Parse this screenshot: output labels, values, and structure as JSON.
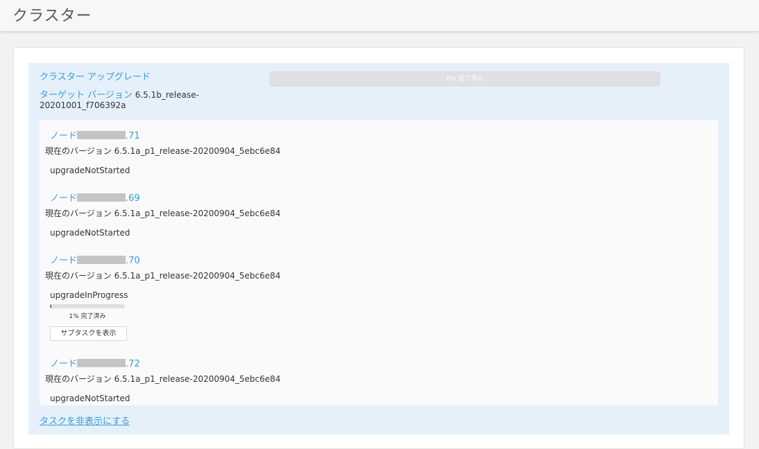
{
  "header": {
    "title": "クラスター"
  },
  "upgrade": {
    "title": "クラスター アップグレード",
    "progress_label": "0% 完了済み",
    "progress_fraction": 0.0,
    "target_version_label": "ターゲット バージョン",
    "target_version_value": "6.5.1b_release-20201001_f706392a",
    "hide_tasks_label": "タスクを非表示にする"
  },
  "nodes": [
    {
      "name_prefix": "ノード",
      "name_suffix": ".71",
      "version_label": "現在のバージョン",
      "version_value": "6.5.1a_p1_release-20200904_5ebc6e84",
      "state": "upgradeNotStarted"
    },
    {
      "name_prefix": "ノード",
      "name_suffix": ".69",
      "version_label": "現在のバージョン",
      "version_value": "6.5.1a_p1_release-20200904_5ebc6e84",
      "state": "upgradeNotStarted"
    },
    {
      "name_prefix": "ノード",
      "name_suffix": ".70",
      "version_label": "現在のバージョン",
      "version_value": "6.5.1a_p1_release-20200904_5ebc6e84",
      "state": "upgradeInProgress",
      "progress_fraction": 0.01,
      "progress_label": "1% 完了済み",
      "subtask_button_label": "サブタスクを表示"
    },
    {
      "name_prefix": "ノード",
      "name_suffix": ".72",
      "version_label": "現在のバージョン",
      "version_value": "6.5.1a_p1_release-20200904_5ebc6e84",
      "state": "upgradeNotStarted"
    }
  ],
  "colors": {
    "accent": "#3a9ad9",
    "panel_background": "#e5f0fb",
    "progress_fill": "#3a6fb0"
  }
}
